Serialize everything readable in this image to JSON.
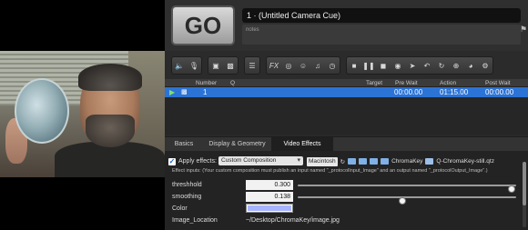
{
  "cue": {
    "go_label": "GO",
    "name": "1 · (Untitled Camera Cue)",
    "notes_placeholder": "notes"
  },
  "table": {
    "headers": {
      "number": "Number",
      "q": "Q",
      "target": "Target",
      "pre_wait": "Pre Wait",
      "action": "Action",
      "post_wait": "Post Wait"
    },
    "row": {
      "number": "1",
      "pre_wait": "00:00.00",
      "action": "01:15.00",
      "post_wait": "00:00.00"
    }
  },
  "tabs": [
    {
      "label": "Basics"
    },
    {
      "label": "Display & Geometry"
    },
    {
      "label": "Video Effects",
      "active": true
    }
  ],
  "effects": {
    "apply_label": "Apply effects:",
    "apply_checked": true,
    "composition": "Custom Composition",
    "path": {
      "drive": "Macintosh",
      "folder": "ChromaKey",
      "file": "Q-ChromaKey-still.qtz"
    },
    "info": "Effect inputs:  (Your custom composition must publish an input named \"_protocolInput_Image\" and an output named \"_protocolOutput_Image\".)",
    "params": [
      {
        "label": "threshhold",
        "value": "0.300",
        "fraction": 0.98
      },
      {
        "label": "smoothing",
        "value": "0.138",
        "fraction": 0.48
      },
      {
        "label": "Color",
        "color": "#a7b4ff"
      },
      {
        "label": "Image_Location",
        "value": "~/Desktop/ChromaKey/image.jpg"
      }
    ]
  },
  "colors": {
    "selected_row": "#2c73d6",
    "accent_green": "#7fe06e"
  },
  "icons": {
    "toolbar": [
      "speaker-icon",
      "microphone-icon",
      "video-icon",
      "camera-icon",
      "sliders-icon",
      "fx-icon",
      "target-icon",
      "face-icon",
      "music-note-icon",
      "clock-icon",
      "stop-icon",
      "pause-icon",
      "square-icon",
      "record-icon",
      "go-icon",
      "undo-icon",
      "refresh-icon",
      "plus-circle-icon",
      "gauge-icon",
      "lock-icon"
    ]
  }
}
